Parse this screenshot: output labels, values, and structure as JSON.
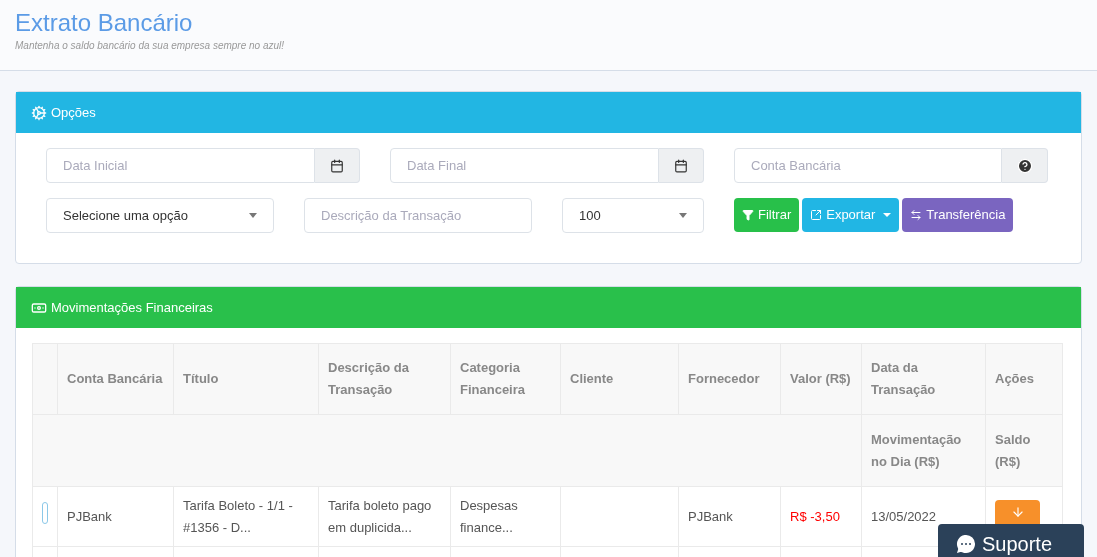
{
  "page": {
    "title": "Extrato Bancário",
    "subtitle": "Mantenha o saldo bancário da sua empresa sempre no azul!"
  },
  "options_panel": {
    "title": "Opções",
    "date_fields": [
      {
        "placeholder": "Data Inicial"
      },
      {
        "placeholder": "Data Final"
      }
    ],
    "account_field": {
      "placeholder": "Conta Bancária"
    },
    "type_select": {
      "value": "Selecione uma opção"
    },
    "description_field": {
      "placeholder": "Descrição da Transação"
    },
    "page_size_select": {
      "value": "100"
    },
    "buttons": [
      {
        "kind": "filter",
        "label": "Filtrar"
      },
      {
        "kind": "export",
        "label": "Exportar"
      },
      {
        "kind": "transfer",
        "label": "Transferência"
      }
    ]
  },
  "movements_panel": {
    "title": "Movimentações Financeiras",
    "table": {
      "columns": [
        "Conta Bancária",
        "Título",
        "Descrição da Transação",
        "Categoria Financeira",
        "Cliente",
        "Fornecedor",
        "Valor (R$)",
        "Data da Transação",
        "Ações"
      ],
      "subheader": [
        "Movimentação no Dia (R$)",
        "Saldo (R$)"
      ],
      "rows": [
        {
          "account": "PJBank",
          "title": "Tarifa Boleto - 1/1 - #1356 - D...",
          "description": "Tarifa boleto pago em duplicida...",
          "category": "Despesas finance...",
          "client": "",
          "supplier": "PJBank",
          "value": "R$ -3,50",
          "negative": true,
          "date": "13/05/2022"
        }
      ]
    }
  },
  "support_button": {
    "label": "Suporte"
  }
}
